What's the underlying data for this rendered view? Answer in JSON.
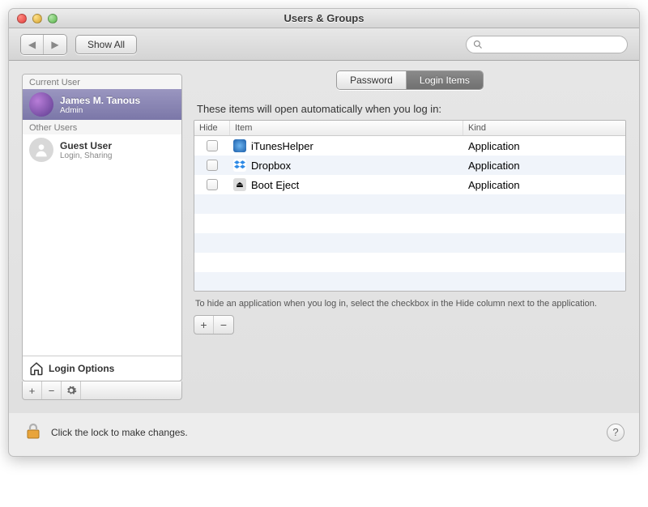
{
  "window": {
    "title": "Users & Groups"
  },
  "toolbar": {
    "show_all": "Show All",
    "search_placeholder": ""
  },
  "sidebar": {
    "current_header": "Current User",
    "other_header": "Other Users",
    "login_options": "Login Options",
    "users": [
      {
        "name": "James M. Tanous",
        "role": "Admin"
      },
      {
        "name": "Guest User",
        "role": "Login, Sharing"
      }
    ]
  },
  "tabs": {
    "password": "Password",
    "login_items": "Login Items"
  },
  "main": {
    "intro": "These items will open automatically when you log in:",
    "columns": {
      "hide": "Hide",
      "item": "Item",
      "kind": "Kind"
    },
    "items": [
      {
        "name": "iTunesHelper",
        "kind": "Application"
      },
      {
        "name": "Dropbox",
        "kind": "Application"
      },
      {
        "name": "Boot Eject",
        "kind": "Application"
      }
    ],
    "hint": "To hide an application when you log in, select the checkbox in the Hide column next to the application."
  },
  "footer": {
    "lock_text": "Click the lock to make changes."
  }
}
